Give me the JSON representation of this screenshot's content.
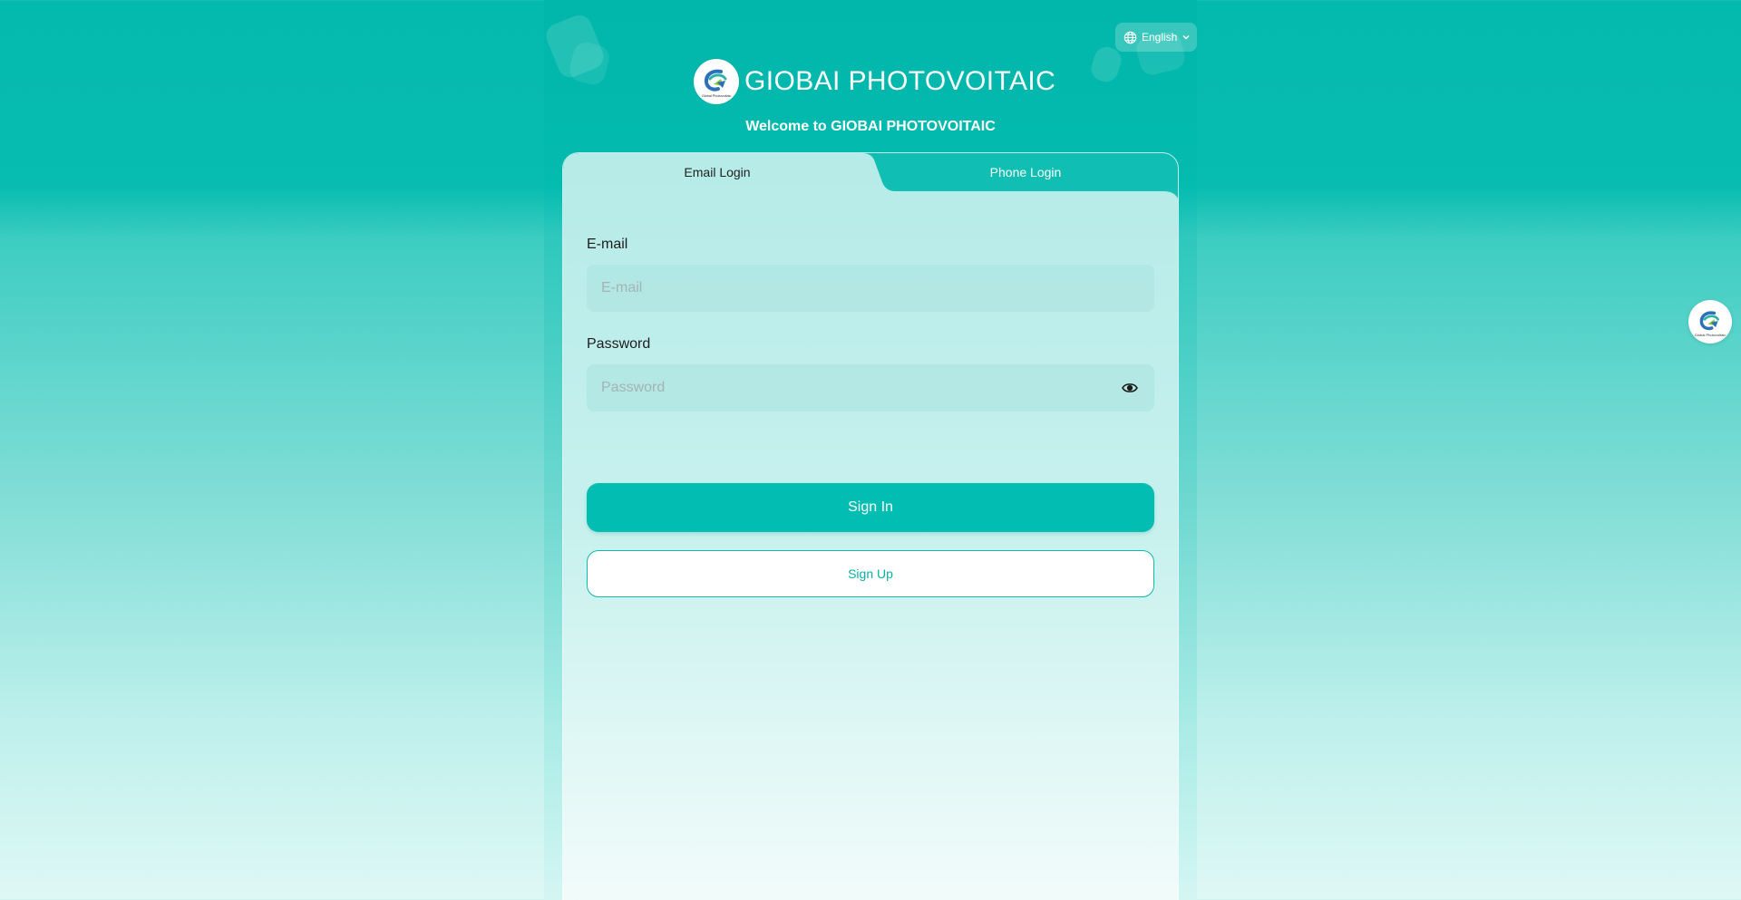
{
  "language": {
    "label": "English",
    "icon": "globe-icon",
    "chevron": "chevron-down-icon"
  },
  "brand": {
    "title": "GIOBAI PHOTOVOITAIC",
    "logo_text": "Global Photovoltaic"
  },
  "welcome": "Welcome to GIOBAI PHOTOVOITAIC",
  "tabs": [
    {
      "label": "Email Login",
      "active": true
    },
    {
      "label": "Phone Login",
      "active": false
    }
  ],
  "form": {
    "email": {
      "label": "E-mail",
      "placeholder": "E-mail",
      "value": ""
    },
    "password": {
      "label": "Password",
      "placeholder": "Password",
      "value": "",
      "toggle_icon": "eye-icon"
    },
    "sign_in": "Sign In",
    "sign_up": "Sign Up"
  },
  "floating": {
    "logo_text": "Global Photovoltaic"
  },
  "colors": {
    "primary": "#02bdb1",
    "background_top": "#04b9ad",
    "background_bottom": "#dff8f5",
    "card_panel": "#b6ebe8",
    "input_background": "#aae1de"
  }
}
